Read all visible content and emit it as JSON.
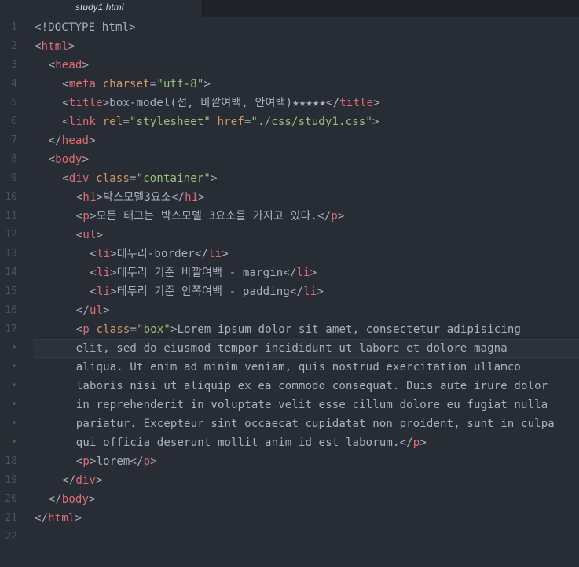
{
  "tab": {
    "title": "study1.html"
  },
  "colors": {
    "tag": "#e06c75",
    "attribute": "#d19a66",
    "string": "#98c379",
    "text": "#abb2bf",
    "gutter": "#4b5263",
    "background": "#282c34"
  },
  "lines": [
    {
      "num": "1",
      "indent": 0,
      "tokens": [
        [
          "pun",
          "<!DOCTYPE html>"
        ]
      ]
    },
    {
      "num": "2",
      "indent": 0,
      "tokens": [
        [
          "pun",
          "<"
        ],
        [
          "tag",
          "html"
        ],
        [
          "pun",
          ">"
        ]
      ]
    },
    {
      "num": "3",
      "indent": 1,
      "tokens": [
        [
          "pun",
          "<"
        ],
        [
          "tag",
          "head"
        ],
        [
          "pun",
          ">"
        ]
      ]
    },
    {
      "num": "4",
      "indent": 2,
      "tokens": [
        [
          "pun",
          "<"
        ],
        [
          "tag",
          "meta"
        ],
        [
          "pun",
          " "
        ],
        [
          "attr",
          "charset"
        ],
        [
          "pun",
          "="
        ],
        [
          "str",
          "\"utf-8\""
        ],
        [
          "pun",
          ">"
        ]
      ]
    },
    {
      "num": "5",
      "indent": 2,
      "tokens": [
        [
          "pun",
          "<"
        ],
        [
          "tag",
          "title"
        ],
        [
          "pun",
          ">"
        ],
        [
          "txt",
          "box-model(선, 바깥여백, 안여백)★★★★★"
        ],
        [
          "pun",
          "</"
        ],
        [
          "tag",
          "title"
        ],
        [
          "pun",
          ">"
        ]
      ]
    },
    {
      "num": "6",
      "indent": 2,
      "tokens": [
        [
          "pun",
          "<"
        ],
        [
          "tag",
          "link"
        ],
        [
          "pun",
          " "
        ],
        [
          "attr",
          "rel"
        ],
        [
          "pun",
          "="
        ],
        [
          "str",
          "\"stylesheet\""
        ],
        [
          "pun",
          " "
        ],
        [
          "attr",
          "href"
        ],
        [
          "pun",
          "="
        ],
        [
          "str",
          "\"./css/study1.css\""
        ],
        [
          "pun",
          ">"
        ]
      ]
    },
    {
      "num": "7",
      "indent": 1,
      "tokens": [
        [
          "pun",
          "</"
        ],
        [
          "tag",
          "head"
        ],
        [
          "pun",
          ">"
        ]
      ]
    },
    {
      "num": "8",
      "indent": 1,
      "tokens": [
        [
          "pun",
          "<"
        ],
        [
          "tag",
          "body"
        ],
        [
          "pun",
          ">"
        ]
      ]
    },
    {
      "num": "9",
      "indent": 2,
      "tokens": [
        [
          "pun",
          "<"
        ],
        [
          "tag",
          "div"
        ],
        [
          "pun",
          " "
        ],
        [
          "attr",
          "class"
        ],
        [
          "pun",
          "="
        ],
        [
          "str",
          "\"container\""
        ],
        [
          "pun",
          ">"
        ]
      ]
    },
    {
      "num": "10",
      "indent": 3,
      "tokens": [
        [
          "pun",
          "<"
        ],
        [
          "tag",
          "h1"
        ],
        [
          "pun",
          ">"
        ],
        [
          "txt",
          "박스모델3요소"
        ],
        [
          "pun",
          "</"
        ],
        [
          "tag",
          "h1"
        ],
        [
          "pun",
          ">"
        ]
      ]
    },
    {
      "num": "11",
      "indent": 3,
      "tokens": [
        [
          "pun",
          "<"
        ],
        [
          "tag",
          "p"
        ],
        [
          "pun",
          ">"
        ],
        [
          "txt",
          "모든 태그는 박스모델 3요소를 가지고 있다."
        ],
        [
          "pun",
          "</"
        ],
        [
          "tag",
          "p"
        ],
        [
          "pun",
          ">"
        ]
      ]
    },
    {
      "num": "12",
      "indent": 3,
      "tokens": [
        [
          "pun",
          "<"
        ],
        [
          "tag",
          "ul"
        ],
        [
          "pun",
          ">"
        ]
      ]
    },
    {
      "num": "13",
      "indent": 4,
      "tokens": [
        [
          "pun",
          "<"
        ],
        [
          "tag",
          "li"
        ],
        [
          "pun",
          ">"
        ],
        [
          "txt",
          "테두리-border"
        ],
        [
          "pun",
          "</"
        ],
        [
          "tag",
          "li"
        ],
        [
          "pun",
          ">"
        ]
      ]
    },
    {
      "num": "14",
      "indent": 4,
      "tokens": [
        [
          "pun",
          "<"
        ],
        [
          "tag",
          "li"
        ],
        [
          "pun",
          ">"
        ],
        [
          "txt",
          "테두리 기준 바깥여백 - margin"
        ],
        [
          "pun",
          "</"
        ],
        [
          "tag",
          "li"
        ],
        [
          "pun",
          ">"
        ]
      ]
    },
    {
      "num": "15",
      "indent": 4,
      "tokens": [
        [
          "pun",
          "<"
        ],
        [
          "tag",
          "li"
        ],
        [
          "pun",
          ">"
        ],
        [
          "txt",
          "테두리 기준 안쪽여백 - padding"
        ],
        [
          "pun",
          "</"
        ],
        [
          "tag",
          "li"
        ],
        [
          "pun",
          ">"
        ]
      ]
    },
    {
      "num": "16",
      "indent": 3,
      "tokens": [
        [
          "pun",
          "</"
        ],
        [
          "tag",
          "ul"
        ],
        [
          "pun",
          ">"
        ]
      ]
    },
    {
      "num": "17",
      "indent": 3,
      "tokens": [
        [
          "pun",
          "<"
        ],
        [
          "tag",
          "p"
        ],
        [
          "pun",
          " "
        ],
        [
          "attr",
          "class"
        ],
        [
          "pun",
          "="
        ],
        [
          "str",
          "\"box\""
        ],
        [
          "pun",
          ">"
        ],
        [
          "txt",
          "Lorem ipsum dolor sit amet, consectetur adipisicing"
        ]
      ]
    },
    {
      "num": "•",
      "indent": 3,
      "cursor": true,
      "tokens": [
        [
          "txt",
          "elit, sed do eiusmod tempor incididunt ut labore et dolore magna"
        ]
      ]
    },
    {
      "num": "•",
      "indent": 3,
      "tokens": [
        [
          "txt",
          "aliqua. Ut enim ad minim veniam, quis nostrud exercitation ullamco"
        ]
      ]
    },
    {
      "num": "•",
      "indent": 3,
      "tokens": [
        [
          "txt",
          "laboris nisi ut aliquip ex ea commodo consequat. Duis aute irure dolor"
        ]
      ]
    },
    {
      "num": "•",
      "indent": 3,
      "tokens": [
        [
          "txt",
          "in reprehenderit in voluptate velit esse cillum dolore eu fugiat nulla"
        ]
      ]
    },
    {
      "num": "•",
      "indent": 3,
      "tokens": [
        [
          "txt",
          "pariatur. Excepteur sint occaecat cupidatat non proident, sunt in culpa"
        ]
      ]
    },
    {
      "num": "•",
      "indent": 3,
      "tokens": [
        [
          "txt",
          "qui officia deserunt mollit anim id est laborum."
        ],
        [
          "pun",
          "</"
        ],
        [
          "tag",
          "p"
        ],
        [
          "pun",
          ">"
        ]
      ]
    },
    {
      "num": "18",
      "indent": 3,
      "tokens": [
        [
          "pun",
          "<"
        ],
        [
          "tag",
          "p"
        ],
        [
          "pun",
          ">"
        ],
        [
          "txt",
          "lorem"
        ],
        [
          "pun",
          "</"
        ],
        [
          "tag",
          "p"
        ],
        [
          "pun",
          ">"
        ]
      ]
    },
    {
      "num": "19",
      "indent": 2,
      "tokens": [
        [
          "pun",
          "</"
        ],
        [
          "tag",
          "div"
        ],
        [
          "pun",
          ">"
        ]
      ]
    },
    {
      "num": "20",
      "indent": 1,
      "tokens": [
        [
          "pun",
          "</"
        ],
        [
          "tag",
          "body"
        ],
        [
          "pun",
          ">"
        ]
      ]
    },
    {
      "num": "21",
      "indent": 0,
      "tokens": [
        [
          "pun",
          "</"
        ],
        [
          "tag",
          "html"
        ],
        [
          "pun",
          ">"
        ]
      ]
    },
    {
      "num": "22",
      "indent": 0,
      "tokens": []
    }
  ]
}
